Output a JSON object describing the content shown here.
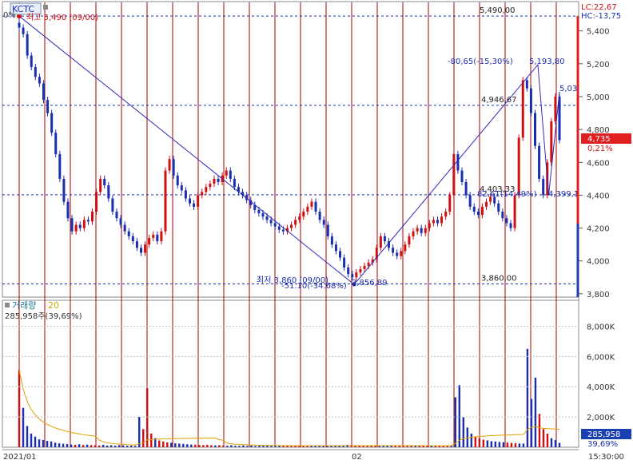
{
  "window": {
    "ticker": "KCTC",
    "zero_pct": "0%",
    "lc_label": "LC:22,67",
    "hc_label": "HC:-13,75",
    "time_label": "15:30:00"
  },
  "price_panel": {
    "high_annotation": "최고 5,490 (09/00)",
    "low_annotation": "최저 3,860 (09/00)",
    "low_pct_annotation": "-51.10(-34.68%)",
    "current_price": "4,735",
    "current_change": "0,21%",
    "colors": {
      "up": "#d01010",
      "down": "#1a2fb0",
      "line": "#2a2ab8",
      "grid": "#b00000"
    }
  },
  "volume_panel": {
    "title": "거래량",
    "ma_period": "20",
    "summary": "285,958주(39,69%)",
    "current_volume": "285,958",
    "current_ratio": "39,69%"
  },
  "chart_data": [
    {
      "type": "candlestick",
      "ylim": [
        3780,
        5520
      ],
      "yticks": [
        "3,800",
        "4,000",
        "4,200",
        "4,400",
        "4,600",
        "4,800",
        "5,000",
        "5,200",
        "5,400"
      ],
      "x_labels": [
        "2021/01",
        "02"
      ],
      "trend_points": [
        {
          "pos": 0.0,
          "y": 5490
        },
        {
          "pos": 0.62,
          "y": 3857
        },
        {
          "pos": 0.96,
          "y": 5194
        },
        {
          "pos": 0.98,
          "y": 4399
        },
        {
          "pos": 1.0,
          "y": 5030
        }
      ],
      "levels": [
        {
          "label": "5,490,00",
          "value": 5490
        },
        {
          "label": "4,946,67",
          "value": 4947
        },
        {
          "label": "4,403,33",
          "value": 4403
        },
        {
          "label": "3,860,00",
          "value": 3860
        }
      ],
      "annotations": [
        "-80,65(-15,30%)",
        "5,193,80",
        "5,03",
        "82,61(14,49%)",
        "4,399,1",
        "3,856,89"
      ],
      "price_series": [
        5420,
        5380,
        5250,
        5180,
        5120,
        5080,
        4980,
        4900,
        4780,
        4650,
        4500,
        4360,
        4260,
        4180,
        4220,
        4200,
        4250,
        4240,
        4300,
        4420,
        4500,
        4460,
        4380,
        4300,
        4260,
        4220,
        4180,
        4150,
        4120,
        4080,
        4050,
        4100,
        4140,
        4160,
        4120,
        4180,
        4550,
        4620,
        4520,
        4460,
        4430,
        4380,
        4350,
        4330,
        4400,
        4420,
        4450,
        4470,
        4500,
        4480,
        4520,
        4550,
        4500,
        4450,
        4420,
        4400,
        4370,
        4340,
        4310,
        4290,
        4270,
        4250,
        4230,
        4210,
        4190,
        4180,
        4200,
        4220,
        4250,
        4270,
        4300,
        4330,
        4360,
        4300,
        4250,
        4220,
        4150,
        4100,
        4060,
        4020,
        3960,
        3920,
        3900,
        3930,
        3950,
        3970,
        3990,
        4010,
        4080,
        4150,
        4120,
        4080,
        4050,
        4030,
        4060,
        4100,
        4150,
        4180,
        4200,
        4170,
        4200,
        4230,
        4250,
        4230,
        4270,
        4300,
        4400,
        4650,
        4550,
        4480,
        4400,
        4330,
        4300,
        4280,
        4330,
        4360,
        4390,
        4350,
        4300,
        4260,
        4230,
        4200,
        4400,
        4750,
        5100,
        5050,
        4900,
        4700,
        4500,
        4400,
        4600,
        4850,
        5000,
        4735
      ],
      "volume_ylim": [
        0,
        9500
      ],
      "volume_yticks": [
        "2,000K",
        "4,000K",
        "6,000K",
        "8,000K"
      ],
      "volume_series": [
        5100,
        2600,
        1400,
        900,
        700,
        520,
        480,
        420,
        380,
        300,
        260,
        230,
        210,
        180,
        160,
        200,
        150,
        170,
        140,
        130,
        120,
        160,
        110,
        130,
        100,
        140,
        120,
        95,
        110,
        90,
        2000,
        1200,
        3900,
        900,
        600,
        450,
        380,
        320,
        300,
        260,
        240,
        220,
        200,
        180,
        170,
        150,
        140,
        160,
        130,
        120,
        140,
        110,
        100,
        130,
        95,
        90,
        120,
        85,
        110,
        80,
        100,
        95,
        120,
        90,
        85,
        110,
        90,
        80,
        95,
        120,
        100,
        90,
        85,
        110,
        100,
        90,
        85,
        95,
        110,
        120,
        100,
        130,
        160,
        140,
        120,
        110,
        100,
        95,
        90,
        85,
        110,
        100,
        120,
        95,
        90,
        85,
        100,
        90,
        95,
        110,
        120,
        100,
        105,
        90,
        85,
        95,
        100,
        110,
        120,
        3300,
        4100,
        2000,
        1300,
        900,
        700,
        600,
        500,
        450,
        400,
        380,
        350,
        330,
        300,
        280,
        260,
        250,
        240,
        6500,
        3200,
        4600,
        2200,
        1200,
        900,
        600,
        480,
        286
      ]
    }
  ]
}
